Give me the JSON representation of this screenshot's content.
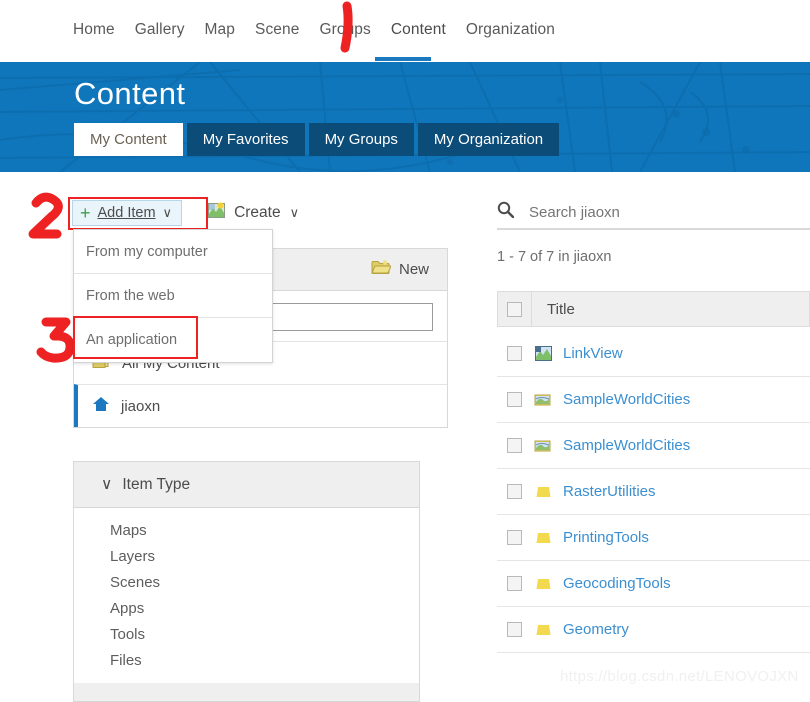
{
  "nav": {
    "items": [
      {
        "label": "Home",
        "active": false
      },
      {
        "label": "Gallery",
        "active": false
      },
      {
        "label": "Map",
        "active": false
      },
      {
        "label": "Scene",
        "active": false
      },
      {
        "label": "Groups",
        "active": false
      },
      {
        "label": "Content",
        "active": true
      },
      {
        "label": "Organization",
        "active": false
      }
    ]
  },
  "banner": {
    "title": "Content",
    "background_color": "#0f76bb",
    "tabs": [
      {
        "label": "My Content",
        "active": true
      },
      {
        "label": "My Favorites",
        "active": false
      },
      {
        "label": "My Groups",
        "active": false
      },
      {
        "label": "My Organization",
        "active": false
      }
    ]
  },
  "toolbar": {
    "add_item_label": "Add Item",
    "add_item_caret": "∨",
    "create_label": "Create",
    "create_caret": "∨",
    "plus_glyph": "+"
  },
  "add_item_menu": {
    "items": [
      {
        "label": "From my computer"
      },
      {
        "label": "From the web"
      },
      {
        "label": "An application"
      }
    ]
  },
  "folders": {
    "new_label": "New",
    "search_value": "",
    "rows": [
      {
        "label": "All My Content",
        "icon": "folders-icon",
        "selected": false
      },
      {
        "label": "jiaoxn",
        "icon": "home-icon",
        "selected": true
      }
    ]
  },
  "item_type": {
    "header": "Item Type",
    "chevron": "∨",
    "options": [
      "Maps",
      "Layers",
      "Scenes",
      "Apps",
      "Tools",
      "Files"
    ]
  },
  "search": {
    "placeholder": "Search jiaoxn",
    "value": ""
  },
  "results": {
    "count_text": "1 - 7 of 7 in jiaoxn",
    "column_title": "Title",
    "items": [
      {
        "title": "LinkView",
        "icon": "web-map-icon"
      },
      {
        "title": "SampleWorldCities",
        "icon": "map-service-icon"
      },
      {
        "title": "SampleWorldCities",
        "icon": "map-service-icon"
      },
      {
        "title": "RasterUtilities",
        "icon": "toolbox-icon"
      },
      {
        "title": "PrintingTools",
        "icon": "toolbox-icon"
      },
      {
        "title": "GeocodingTools",
        "icon": "toolbox-icon"
      },
      {
        "title": "Geometry",
        "icon": "toolbox-icon"
      }
    ]
  },
  "annotations": {
    "marks": [
      "1",
      "2",
      "3"
    ],
    "color": "#ee2222"
  },
  "watermark": {
    "text": "https://blog.csdn.net/LENOVOJXN"
  }
}
